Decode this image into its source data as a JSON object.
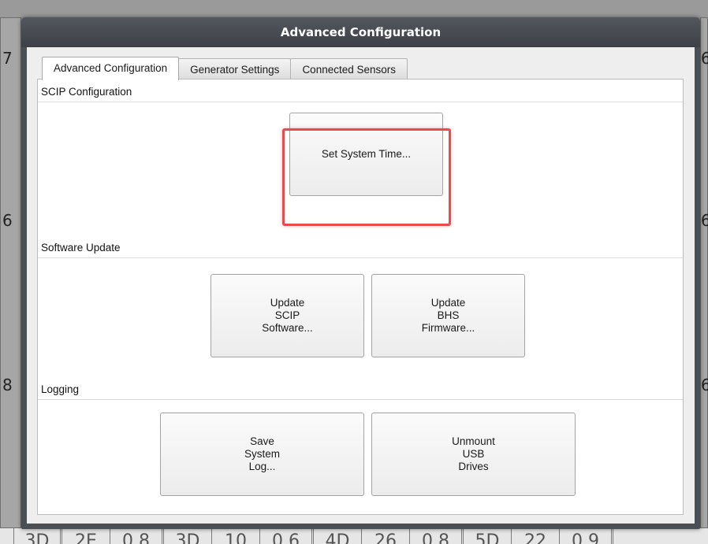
{
  "background": {
    "left_column_digits": [
      "7",
      "6",
      "8"
    ],
    "right_column_digits": [
      "6",
      "6",
      "6"
    ],
    "bottom_row_cells": [
      "3D",
      "2E",
      "0.8",
      "3D",
      "10",
      "0.6",
      "4D",
      "26",
      "0.8",
      "5D",
      "22",
      "0.9"
    ]
  },
  "dialog": {
    "title": "Advanced Configuration",
    "tabs": [
      {
        "label": "Advanced Configuration",
        "active": true
      },
      {
        "label": "Generator Settings",
        "active": false
      },
      {
        "label": "Connected Sensors",
        "active": false
      }
    ],
    "sections": {
      "scip": {
        "label": "SCIP Configuration",
        "set_time_button": [
          "Set System Time..."
        ]
      },
      "software": {
        "label": "Software Update",
        "update_scip_button": [
          "Update",
          "SCIP",
          "Software..."
        ],
        "update_bhs_button": [
          "Update",
          "BHS",
          "Firmware..."
        ]
      },
      "logging": {
        "label": "Logging",
        "save_log_button": [
          "Save",
          "System",
          "Log..."
        ],
        "unmount_button": [
          "Unmount",
          "USB",
          "Drives"
        ]
      }
    },
    "highlight_color": "#e84c4c"
  }
}
